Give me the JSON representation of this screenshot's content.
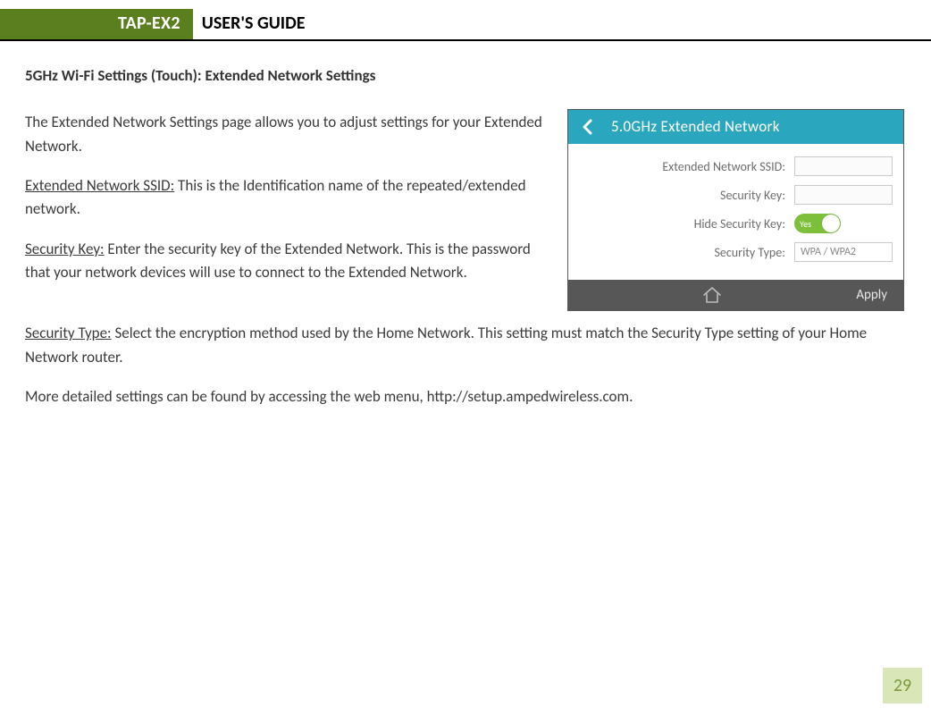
{
  "header": {
    "badge": "TAP-EX2",
    "title": "USER'S GUIDE"
  },
  "heading": "5GHz Wi-Fi Settings (Touch): Extended Network Settings",
  "paras": {
    "intro": "The Extended Network Settings page allows you to adjust settings for your Extended Network.",
    "ssid_term": "Extended Network SSID:",
    "ssid_rest": " This is the Identification name of the repeated/extended network.",
    "key_term": "Security Key:",
    "key_rest": " Enter the security key of the Extended Network. This is the password that your network devices will use to connect to the Extended Network.",
    "type_term": "Security Type:",
    "type_rest": " Select the encryption method used by the Home Network. This setting must match the Security Type setting of your Home Network router.",
    "more": "More detailed settings can be found by accessing the web menu, http://setup.ampedwireless.com."
  },
  "phone": {
    "title": "5.0GHz Extended Network",
    "labels": {
      "ssid": "Extended Network SSID:",
      "key": "Security Key:",
      "hide": "Hide Security Key:",
      "type": "Security Type:"
    },
    "toggle_text": "Yes",
    "type_value": "WPA / WPA2",
    "apply": "Apply"
  },
  "page_number": "29"
}
